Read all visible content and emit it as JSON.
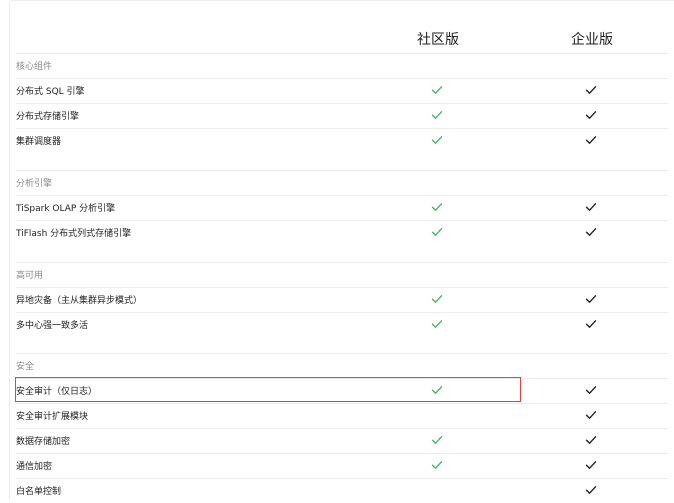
{
  "header": {
    "community": "社区版",
    "enterprise": "企业版"
  },
  "colors": {
    "community_check": "#3fb86b",
    "enterprise_check": "#222222",
    "highlight": "#e0443a",
    "section_text": "#8a8a8a",
    "divider": "#ececec"
  },
  "icons": {
    "check": "check-icon"
  },
  "rows": [
    {
      "type": "section",
      "label": "核心组件"
    },
    {
      "type": "item",
      "label": "分布式 SQL 引擎",
      "community": true,
      "enterprise": true
    },
    {
      "type": "item",
      "label": "分布式存储引擎",
      "community": true,
      "enterprise": true
    },
    {
      "type": "item",
      "label": "集群调度器",
      "community": true,
      "enterprise": true
    },
    {
      "type": "spacer"
    },
    {
      "type": "section",
      "label": "分析引擎"
    },
    {
      "type": "item",
      "label": "TiSpark OLAP 分析引擎",
      "community": true,
      "enterprise": true
    },
    {
      "type": "item",
      "label": "TiFlash 分布式列式存储引擎",
      "community": true,
      "enterprise": true
    },
    {
      "type": "spacer"
    },
    {
      "type": "section",
      "label": "高可用"
    },
    {
      "type": "item",
      "label": "异地灾备（主从集群异步模式）",
      "community": true,
      "enterprise": true
    },
    {
      "type": "item",
      "label": "多中心强一致多活",
      "community": true,
      "enterprise": true
    },
    {
      "type": "spacer"
    },
    {
      "type": "section",
      "label": "安全"
    },
    {
      "type": "item",
      "label": "安全审计（仅日志）",
      "community": true,
      "enterprise": true,
      "highlighted": true
    },
    {
      "type": "item",
      "label": "安全审计扩展模块",
      "community": false,
      "enterprise": true
    },
    {
      "type": "item",
      "label": "数据存储加密",
      "community": true,
      "enterprise": true
    },
    {
      "type": "item",
      "label": "通信加密",
      "community": true,
      "enterprise": true
    },
    {
      "type": "item",
      "label": "白名单控制",
      "community": false,
      "enterprise": true
    }
  ]
}
